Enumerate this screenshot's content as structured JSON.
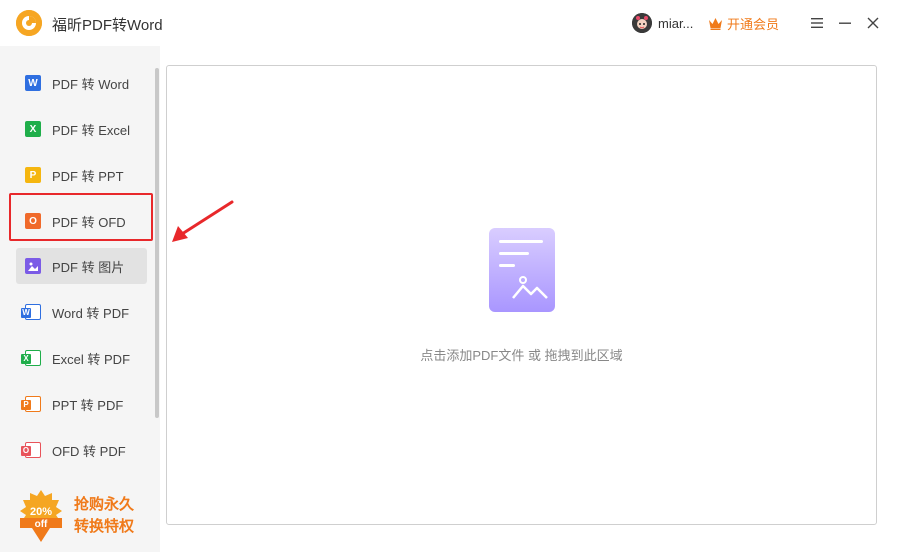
{
  "app": {
    "title": "福昕PDF转Word",
    "logo_icon": "foxit-logo-icon"
  },
  "header": {
    "username": "miar...",
    "vip_label": "开通会员",
    "vip_icon": "crown-icon",
    "menu_icon": "hamburger-menu-icon",
    "minimize_icon": "minimize-icon",
    "close_icon": "close-icon"
  },
  "sidebar": {
    "items": [
      {
        "label": "PDF 转 Word",
        "icon": "word-icon",
        "letter": "W",
        "color": "#2f6fe0",
        "active": false
      },
      {
        "label": "PDF 转 Excel",
        "icon": "excel-icon",
        "letter": "X",
        "color": "#1fae4a",
        "active": false
      },
      {
        "label": "PDF 转 PPT",
        "icon": "ppt-icon",
        "letter": "P",
        "color": "#f5b60f",
        "active": false
      },
      {
        "label": "PDF 转 OFD",
        "icon": "ofd-icon",
        "letter": "O",
        "color": "#f06a2b",
        "active": false
      },
      {
        "label": "PDF 转 图片",
        "icon": "image-icon",
        "letter": "",
        "color": "#7b5be6",
        "active": true
      },
      {
        "label": "Word 转 PDF",
        "icon": "word-to-pdf-icon",
        "letter": "W",
        "color": "#2f6fe0",
        "active": false
      },
      {
        "label": "Excel 转 PDF",
        "icon": "excel-to-pdf-icon",
        "letter": "X",
        "color": "#1fae4a",
        "active": false
      },
      {
        "label": "PPT 转 PDF",
        "icon": "ppt-to-pdf-icon",
        "letter": "P",
        "color": "#f07a1a",
        "active": false
      },
      {
        "label": "OFD 转 PDF",
        "icon": "ofd-to-pdf-icon",
        "letter": "O",
        "color": "#e8535a",
        "active": false
      }
    ],
    "promo": {
      "badge_text": "20%",
      "badge_sub": "off",
      "line1": "抢购永久",
      "line2": "转换特权"
    }
  },
  "main": {
    "drop_hint": "点击添加PDF文件 或 拖拽到此区域",
    "illustration_icon": "document-image-icon",
    "accent": "#b8a6ff"
  },
  "annotations": {
    "highlight_color": "#e8282b"
  }
}
